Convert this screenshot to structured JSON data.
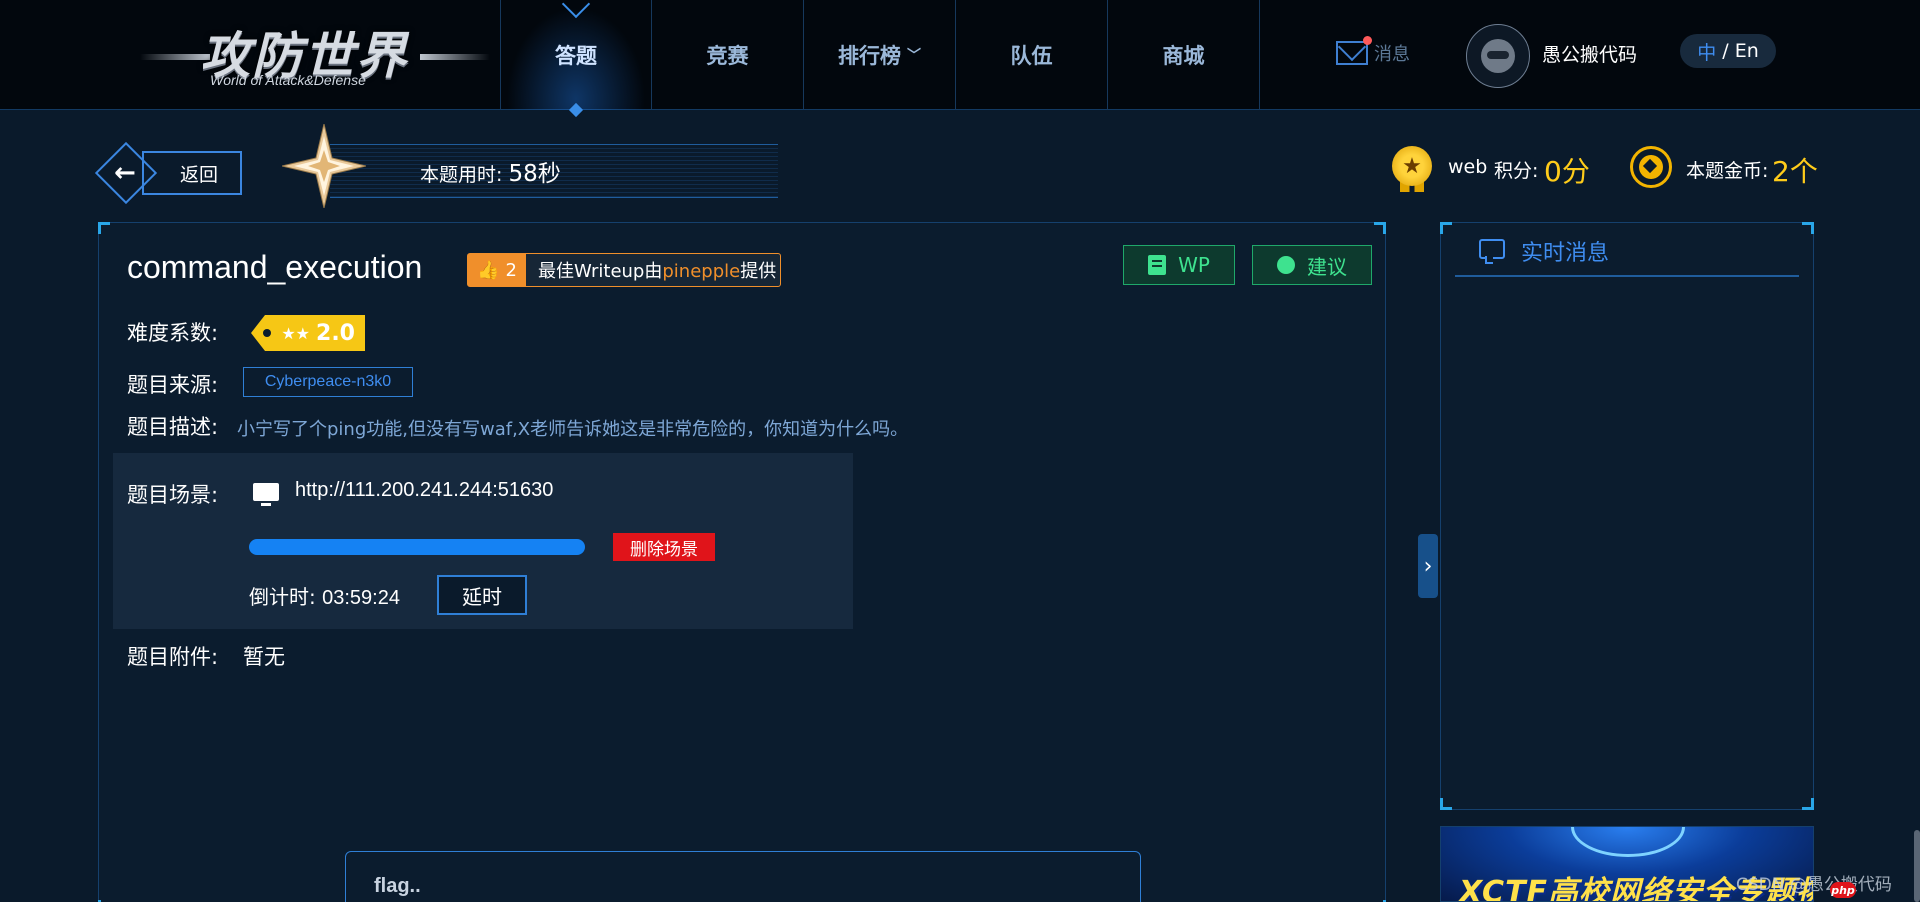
{
  "logo": {
    "main": "攻防世界",
    "sub": "World of Attack&Defense"
  },
  "nav": {
    "items": [
      {
        "label": "答题",
        "active": true
      },
      {
        "label": "竞赛"
      },
      {
        "label": "排行榜",
        "chevron": "chevron-down-icon"
      },
      {
        "label": "队伍"
      },
      {
        "label": "商城"
      }
    ],
    "messages_label": "消息",
    "username": "愚公搬代码",
    "lang_zh": "中",
    "lang_sep": " / ",
    "lang_en": "En"
  },
  "subheader": {
    "back_label": "返回",
    "time_used_label": "本题用时: ",
    "time_used_value": "58秒",
    "category": "web",
    "score_label": "积分:",
    "score_value": "0分",
    "coin_label": "本题金币:",
    "coin_value": "2个"
  },
  "challenge": {
    "title": "command_execution",
    "writeup_likes": "2",
    "writeup_prefix": "最佳Writeup由",
    "writeup_author": "pinepple",
    "writeup_suffix": "提供",
    "wp_button": "WP",
    "suggest_button": "建议",
    "difficulty_label": "难度系数:",
    "difficulty_stars": "★★",
    "difficulty_value": "2.0",
    "source_label": "题目来源:",
    "source_value": "Cyberpeace-n3k0",
    "desc_label": "题目描述:",
    "desc_value": "小宁写了个ping功能,但没有写waf,X老师告诉她这是非常危险的，你知道为什么吗。",
    "scene_label": "题目场景:",
    "scene_url": "http://111.200.241.244:51630",
    "scene_progress": 1.0,
    "delete_scene": "删除场景",
    "countdown_label": "倒计时: ",
    "countdown_value": "03:59:24",
    "extend_button": "延时",
    "attachment_label": "题目附件:",
    "attachment_value": "暂无",
    "flag_placeholder": "flag.."
  },
  "right_panel": {
    "title": "实时消息",
    "banner_text": "XCTF高校网络安全专题挑战赛"
  },
  "watermark": "CSDN @愚公搬代码",
  "colors": {
    "accent": "#3f8df0",
    "gold": "#ffcc1a",
    "danger": "#e0141a",
    "green": "#3ee28f",
    "orange": "#f08f2b"
  }
}
